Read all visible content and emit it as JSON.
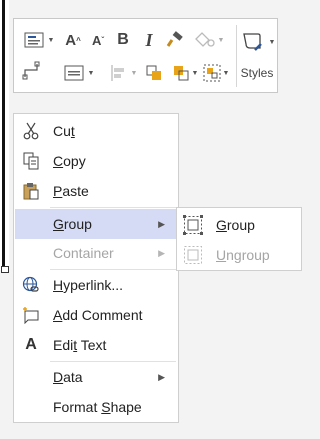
{
  "toolbar": {
    "styles_label": "Styles",
    "buttons": [
      {
        "name": "text-box",
        "icon": "text-box-icon"
      },
      {
        "name": "grow-font",
        "icon": "grow-font-icon"
      },
      {
        "name": "shrink-font",
        "icon": "shrink-font-icon"
      },
      {
        "name": "bold",
        "icon": "bold-icon"
      },
      {
        "name": "italic",
        "icon": "italic-icon"
      },
      {
        "name": "format-painter",
        "icon": "format-painter-icon"
      },
      {
        "name": "shape-fill",
        "icon": "shape-fill-icon"
      },
      {
        "name": "connector",
        "icon": "connector-icon"
      },
      {
        "name": "align-text",
        "icon": "align-text-icon"
      },
      {
        "name": "position",
        "icon": "position-icon"
      },
      {
        "name": "arrange",
        "icon": "arrange-icon"
      },
      {
        "name": "group-shape",
        "icon": "group-shape-icon"
      },
      {
        "name": "styles",
        "icon": "styles-icon"
      }
    ],
    "glyphs": {
      "grow": "A",
      "shrink": "A",
      "bold": "B",
      "italic": "I"
    }
  },
  "menu": {
    "items": [
      {
        "pre": "Cu",
        "key": "t",
        "post": "",
        "icon": "scissors-icon",
        "enabled": true
      },
      {
        "pre": "",
        "key": "C",
        "post": "opy",
        "icon": "copy-icon",
        "enabled": true
      },
      {
        "pre": "",
        "key": "P",
        "post": "aste",
        "icon": "paste-icon",
        "enabled": true
      },
      {
        "pre": "",
        "key": "G",
        "post": "roup",
        "icon": "",
        "enabled": true,
        "submenu": true,
        "highlighted": true
      },
      {
        "pre": "Container",
        "key": "",
        "post": "",
        "icon": "",
        "enabled": false,
        "submenu": true
      },
      {
        "pre": "",
        "key": "H",
        "post": "yperlink...",
        "icon": "hyperlink-icon",
        "enabled": true
      },
      {
        "pre": "",
        "key": "A",
        "post": "dd Comment",
        "icon": "add-comment-icon",
        "enabled": true
      },
      {
        "pre": "Edi",
        "key": "t",
        "post": " Text",
        "icon": "edit-text-icon",
        "enabled": true,
        "glyph": "A"
      },
      {
        "pre": "",
        "key": "D",
        "post": "ata",
        "icon": "",
        "enabled": true,
        "submenu": true
      },
      {
        "pre": "Format ",
        "key": "S",
        "post": "hape",
        "icon": "",
        "enabled": true
      }
    ],
    "submenu_arrow": "▶"
  },
  "submenu": {
    "items": [
      {
        "pre": "",
        "key": "G",
        "post": "roup",
        "icon": "group-icon",
        "enabled": true
      },
      {
        "pre": "",
        "key": "U",
        "post": "ngroup",
        "icon": "ungroup-icon",
        "enabled": false
      }
    ]
  },
  "colors": {
    "highlight": "#d5dbf5",
    "disabled": "#a5a5a5",
    "accent": "#2b579a"
  }
}
